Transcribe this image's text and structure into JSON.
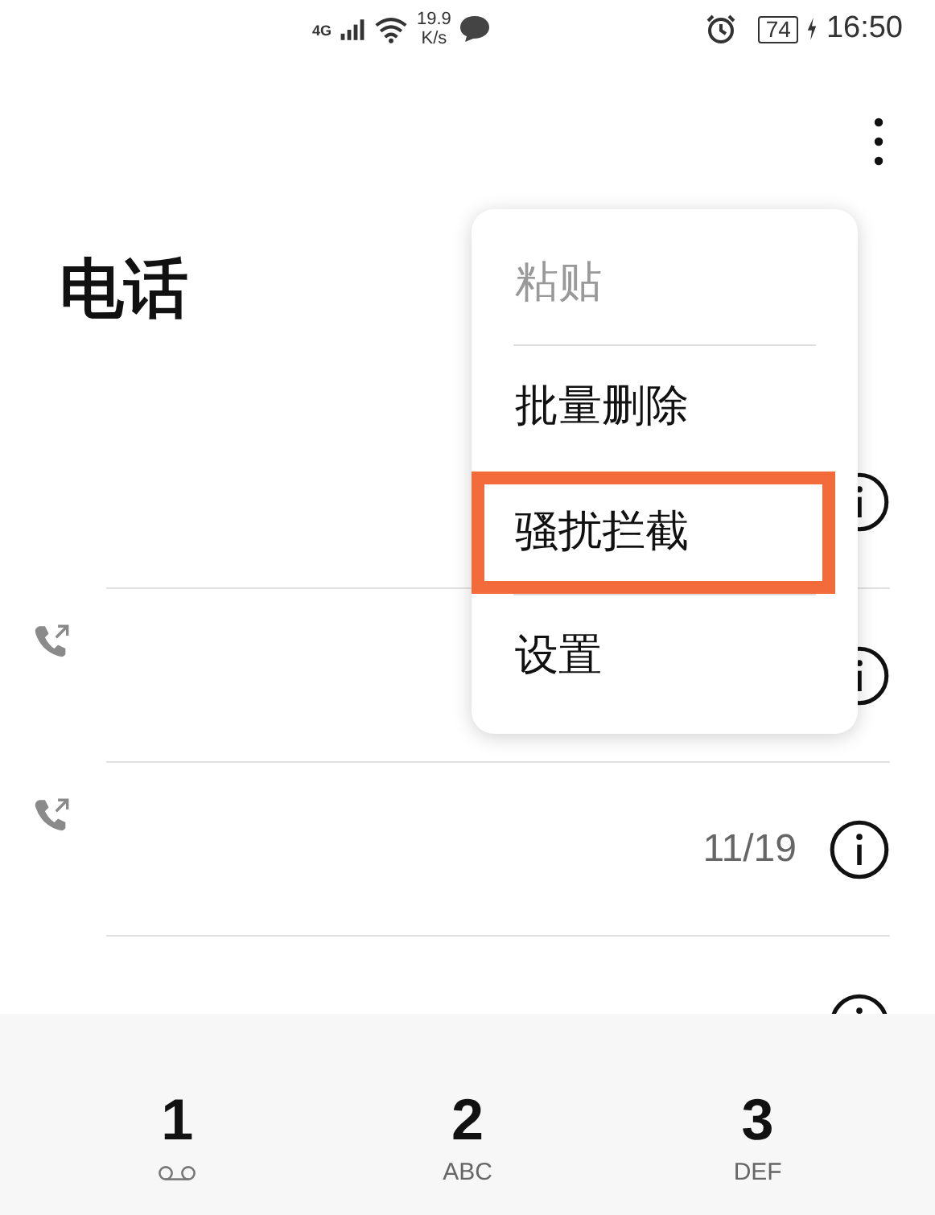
{
  "status_bar": {
    "network": "4G",
    "speed_value": "19.9",
    "speed_unit": "K/s",
    "battery": "74",
    "time": "16:50"
  },
  "title": "电话",
  "calls": [
    {
      "kind": "plain"
    },
    {
      "kind": "outgoing"
    },
    {
      "kind": "outgoing",
      "date": "11/19"
    },
    {
      "kind": "plain"
    }
  ],
  "menu": {
    "items": [
      {
        "kind": "item",
        "label": "粘贴",
        "disabled": true,
        "highlighted": false
      },
      {
        "kind": "divider"
      },
      {
        "kind": "item",
        "label": "批量删除",
        "disabled": false,
        "highlighted": false
      },
      {
        "kind": "item",
        "label": "骚扰拦截",
        "disabled": false,
        "highlighted": true
      },
      {
        "kind": "divider"
      },
      {
        "kind": "item",
        "label": "设置",
        "disabled": false,
        "highlighted": false
      }
    ]
  },
  "keypad": [
    {
      "digit": "1",
      "kind": "voicemail"
    },
    {
      "digit": "2",
      "letters": "ABC",
      "kind": "letters"
    },
    {
      "digit": "3",
      "letters": "DEF",
      "kind": "letters"
    }
  ]
}
